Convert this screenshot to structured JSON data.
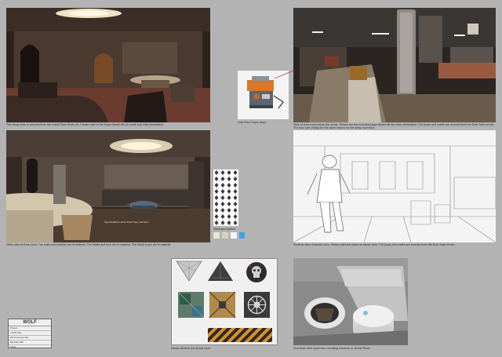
{
  "captions": {
    "living_room": "This living room is sourced from the Lothal Town Room #4. Please refer to the Maya Sketch file for scale and units information.",
    "holo_disc": "Holo Disc Player asset",
    "crew_room": "View of crew room below the house. Please see the included Maya Sketch file for units information. The props and crates are sourced from the Ezra Town lot set.",
    "crew_room_2": "The floor and ceiling are the same texture as the living room floor.",
    "ezra_room": "Other view of Ezra room. The walls and furniture are lit material. The tables and floor are lit material. The Metal props are lit material.",
    "wallpaper": "Wallpaper pattern",
    "line_art": "Reverse view of secret room. Please paint the same as above view. The props and crates are sourced from the Ezra Town lot set.",
    "decals": "Decals detail in the secret room.",
    "overhead": "Overhead view down over revealing entrance to Secret Room.",
    "sign": "Special Effect Lothal Tower Sign, Hot Flow"
  },
  "title_block": {
    "logo": "WOLF",
    "rows": [
      "Project",
      "Lothal City",
      "Ezra's House Set",
      "Episode 109",
      "Artist",
      "Date"
    ]
  },
  "colors": {
    "background": "#b3b3b3",
    "swatches": [
      "#e9e4cf",
      "#d9d3bb",
      "#f5f5f5",
      "#3fa2e0"
    ]
  },
  "icons": [
    "tri-decal-light",
    "tri-decal-dark",
    "skull-emblem",
    "crate-green",
    "crate-orange",
    "imperial-emblem-crate",
    "hazard-stripe"
  ]
}
